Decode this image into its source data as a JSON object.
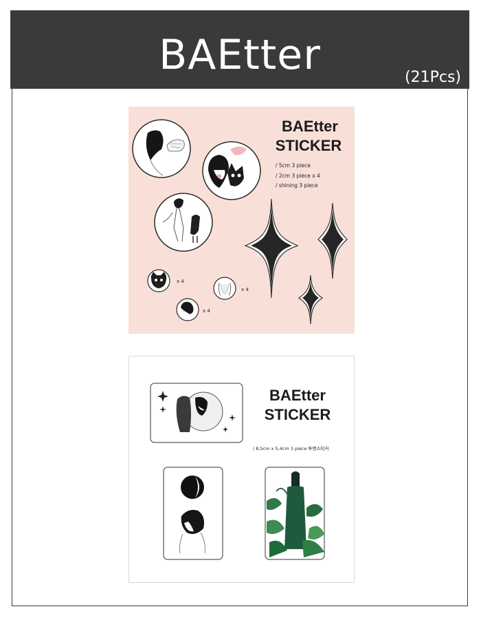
{
  "header": {
    "title": "BAEtter",
    "count": "(21Pcs)",
    "background": "#3a3a39"
  },
  "sheet1": {
    "background": "#f8e0d9",
    "title_line1": "BAEtter",
    "title_line2": "STICKER",
    "specs": [
      "/ 5cm 3 piece",
      "/ 2cm 3 piece x 4",
      "/ shining  3 piece"
    ],
    "multipliers": [
      "x 4",
      "x 4",
      "x 4"
    ]
  },
  "sheet2": {
    "title_line1": "BAEtter",
    "title_line2": "STICKER",
    "spec": "/ 8,5cm x 5,4cm 3 piece 투명스티커"
  }
}
